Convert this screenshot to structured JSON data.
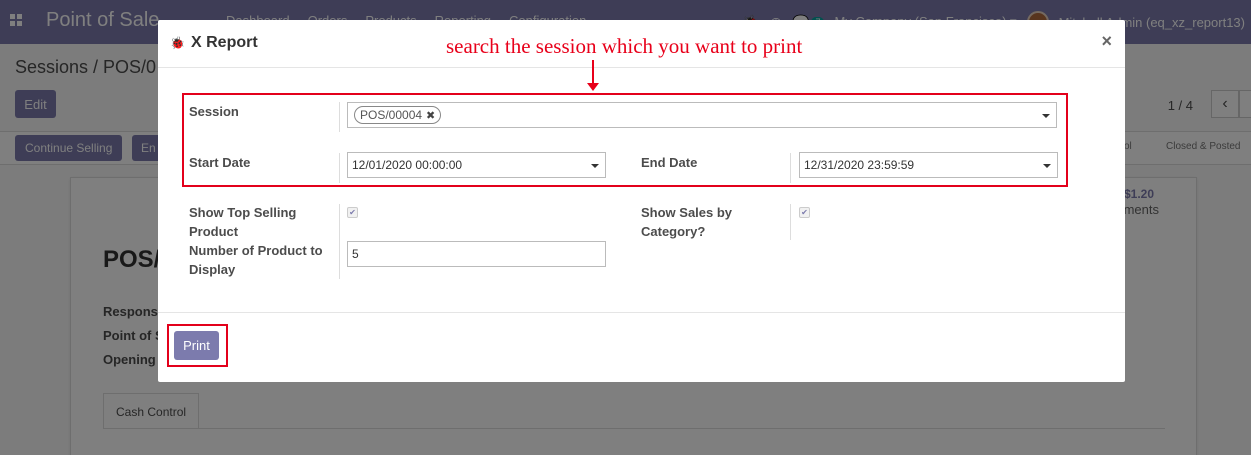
{
  "topbar": {
    "app_title": "Point of Sale",
    "menu": [
      "Dashboard",
      "Orders",
      "Products",
      "Reporting",
      "Configuration"
    ],
    "chat_count": "7",
    "company": "My Company (San Francisco)",
    "user": "Mitchell Admin (eq_xz_report13)"
  },
  "page": {
    "breadcrumb": "Sessions / POS/0",
    "edit_label": "Edit",
    "pager": "1 / 4",
    "continue_selling_label": "Continue Selling",
    "end_label": "En",
    "stage_control": "ol",
    "stage_closed": "Closed & Posted",
    "record_title": "POS/",
    "field_labels": [
      "Respons",
      "Point of S",
      "Opening"
    ],
    "stat_value": "$1.20",
    "stat_label": "ments",
    "tab_cash_control": "Cash Control"
  },
  "modal": {
    "title": "X Report",
    "annotation": "search the session which you want to print",
    "session_label": "Session",
    "session_tag": "POS/00004",
    "start_date_label": "Start Date",
    "start_date": "12/01/2020 00:00:00",
    "end_date_label": "End Date",
    "end_date": "12/31/2020 23:59:59",
    "top_selling_label_1": "Show Top Selling",
    "top_selling_label_2": "Product",
    "num_products_label_1": "Number of Product to",
    "num_products_label_2": "Display",
    "num_products": "5",
    "sales_by_category_label_1": "Show Sales by",
    "sales_by_category_label_2": "Category?",
    "print_label": "Print"
  },
  "colors": {
    "brand": "#7c7bad",
    "annotation": "#e8001a"
  }
}
